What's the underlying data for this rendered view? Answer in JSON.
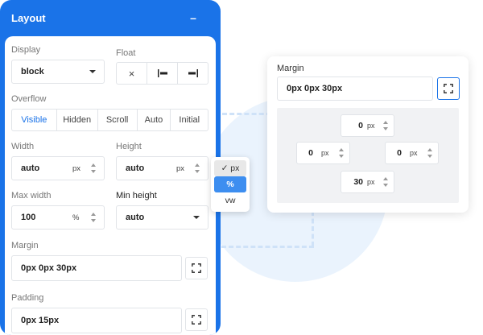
{
  "panel": {
    "title": "Layout",
    "collapse_label": "–",
    "display": {
      "label": "Display",
      "value": "block"
    },
    "float": {
      "label": "Float",
      "options": [
        "×",
        "left",
        "right"
      ]
    },
    "overflow": {
      "label": "Overflow",
      "options": [
        "Visible",
        "Hidden",
        "Scroll",
        "Auto",
        "Initial"
      ],
      "active": "Visible"
    },
    "width": {
      "label": "Width",
      "value": "auto",
      "unit": "px"
    },
    "height": {
      "label": "Height",
      "value": "auto",
      "unit": "px"
    },
    "max_width": {
      "label": "Max width",
      "value": "100",
      "unit": "%"
    },
    "min_height": {
      "label": "Min height",
      "value": "auto"
    },
    "margin": {
      "label": "Margin",
      "value": "0px 0px 30px"
    },
    "padding": {
      "label": "Padding",
      "value": "0px 15px"
    }
  },
  "unit_menu": {
    "options": [
      "✓ px",
      "%",
      "vw"
    ],
    "highlighted": "px",
    "selected": "%"
  },
  "margin_card": {
    "label": "Margin",
    "value": "0px 0px 30px",
    "top": {
      "value": "0",
      "unit": "px"
    },
    "left": {
      "value": "0",
      "unit": "px"
    },
    "right": {
      "value": "0",
      "unit": "px"
    },
    "bottom": {
      "value": "30",
      "unit": "px"
    }
  },
  "colors": {
    "accent": "#1a73e8",
    "selected_option": "#3d8ef0",
    "background_tint": "#eaf3fd"
  }
}
